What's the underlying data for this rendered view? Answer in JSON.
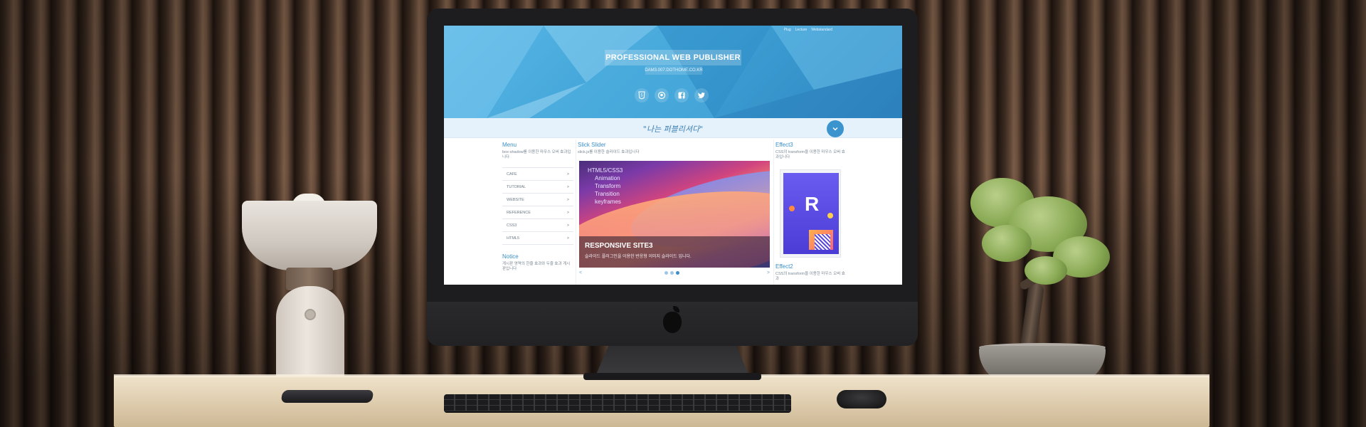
{
  "header": {
    "top_links": [
      "Plug",
      "Lecture",
      "Webstandard"
    ],
    "title": "PROFESSIONAL WEB PUBLISHER",
    "subtitle": "DAM3.007.DOTHOME.CO.KR",
    "social_icons": [
      "html5-icon",
      "github-icon",
      "facebook-icon",
      "twitter-icon"
    ]
  },
  "slogan": "\"나는 퍼블리셔다\"",
  "left_column": {
    "title": "Menu",
    "desc": "box-shadow를 이용한 마우스 오버 효과입니다",
    "menu": [
      {
        "label": "CAFE",
        "arrow": ">"
      },
      {
        "label": "TUTORIAL",
        "arrow": ">"
      },
      {
        "label": "WEBSITE",
        "arrow": ">"
      },
      {
        "label": "REFERENCE",
        "arrow": ">"
      },
      {
        "label": "CSS3",
        "arrow": ">"
      },
      {
        "label": "HTML5",
        "arrow": ">"
      }
    ],
    "notice_title": "Notice",
    "notice_desc": "게시판 영역의 한줄 효과와 두줄 효과 게시판입니다"
  },
  "center_column": {
    "title": "Slick Slider",
    "desc": "slick.js를 이용한 슬라이드 효과입니다",
    "slide_words": [
      "HTML5/CSS3",
      "Animation",
      "Transform",
      "Transition",
      "keyframes"
    ],
    "caption_title": "RESPONSIVE SITE3",
    "caption_text": "슬라이드 플러그인을 이용한 반응형 이미지 슬라이드 입니다.",
    "prev": "<",
    "next": ">"
  },
  "right_column": {
    "title": "Effect3",
    "desc": "CSS의 transform을 이용한 마우스 오버 효과입니다",
    "image_letter": "R",
    "effect2_title": "Effect2",
    "effect2_desc": "CSS의 transform을 이용한 마우스 오버 효과"
  },
  "colors": {
    "accent": "#3a8fc9",
    "hero_blue": "#3ea1d6"
  }
}
